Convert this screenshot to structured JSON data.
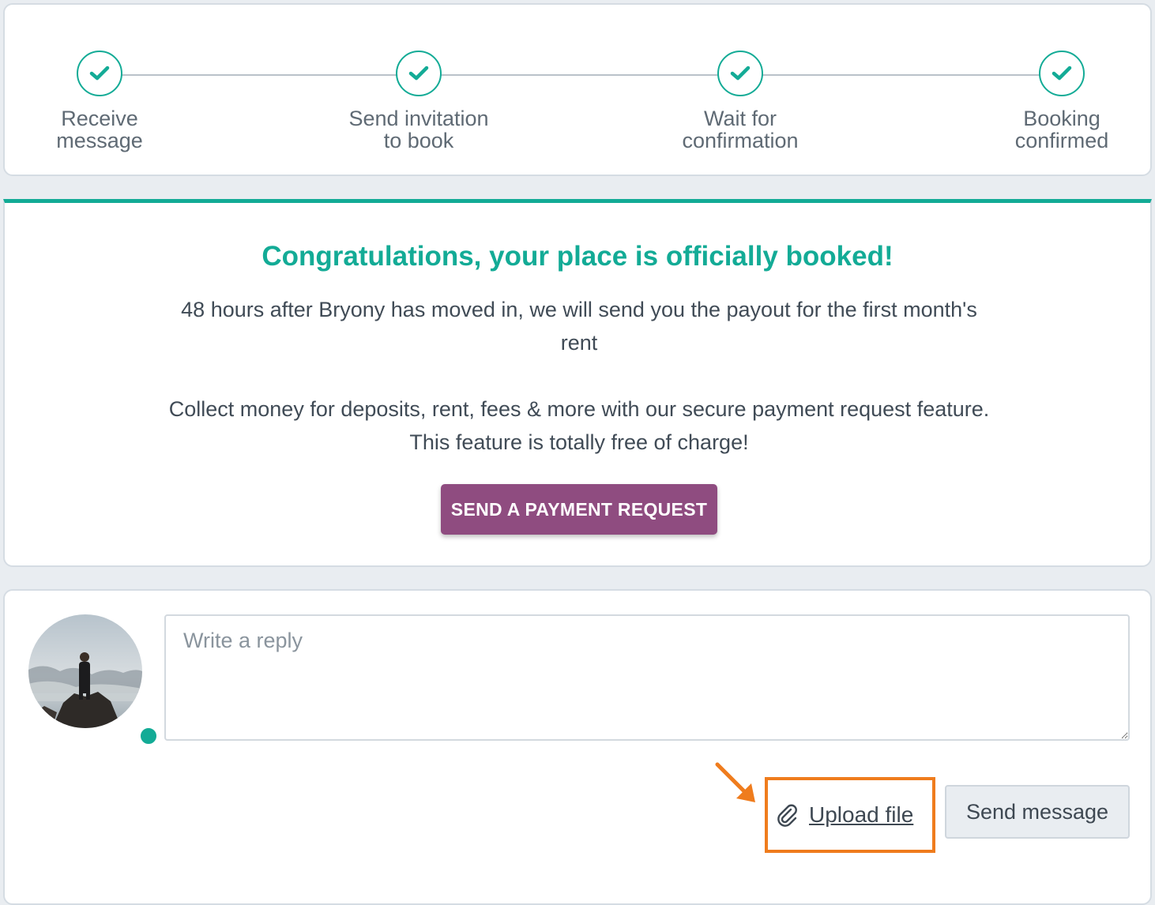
{
  "progress": {
    "steps": [
      {
        "label_line1": "Receive",
        "label_line2": "message",
        "icon": "check-icon"
      },
      {
        "label_line1": "Send invitation",
        "label_line2": "to book",
        "icon": "check-icon"
      },
      {
        "label_line1": "Wait for",
        "label_line2": "confirmation",
        "icon": "check-icon"
      },
      {
        "label_line1": "Booking",
        "label_line2": "confirmed",
        "icon": "check-icon"
      }
    ]
  },
  "congrats": {
    "title": "Congratulations, your place is officially booked!",
    "payout_text": "48 hours after Bryony has moved in, we will send you the payout for the first month's rent",
    "collect_text_line1": "Collect money for deposits, rent, fees & more with our secure payment request feature.",
    "collect_text_line2": "This feature is totally free of charge!",
    "button_label": "SEND A PAYMENT REQUEST"
  },
  "reply": {
    "placeholder": "Write a reply",
    "upload_label": "Upload file",
    "send_label": "Send message"
  },
  "colors": {
    "accent": "#13ab96",
    "primary_button": "#8f4c80",
    "highlight": "#ef7c1d"
  }
}
